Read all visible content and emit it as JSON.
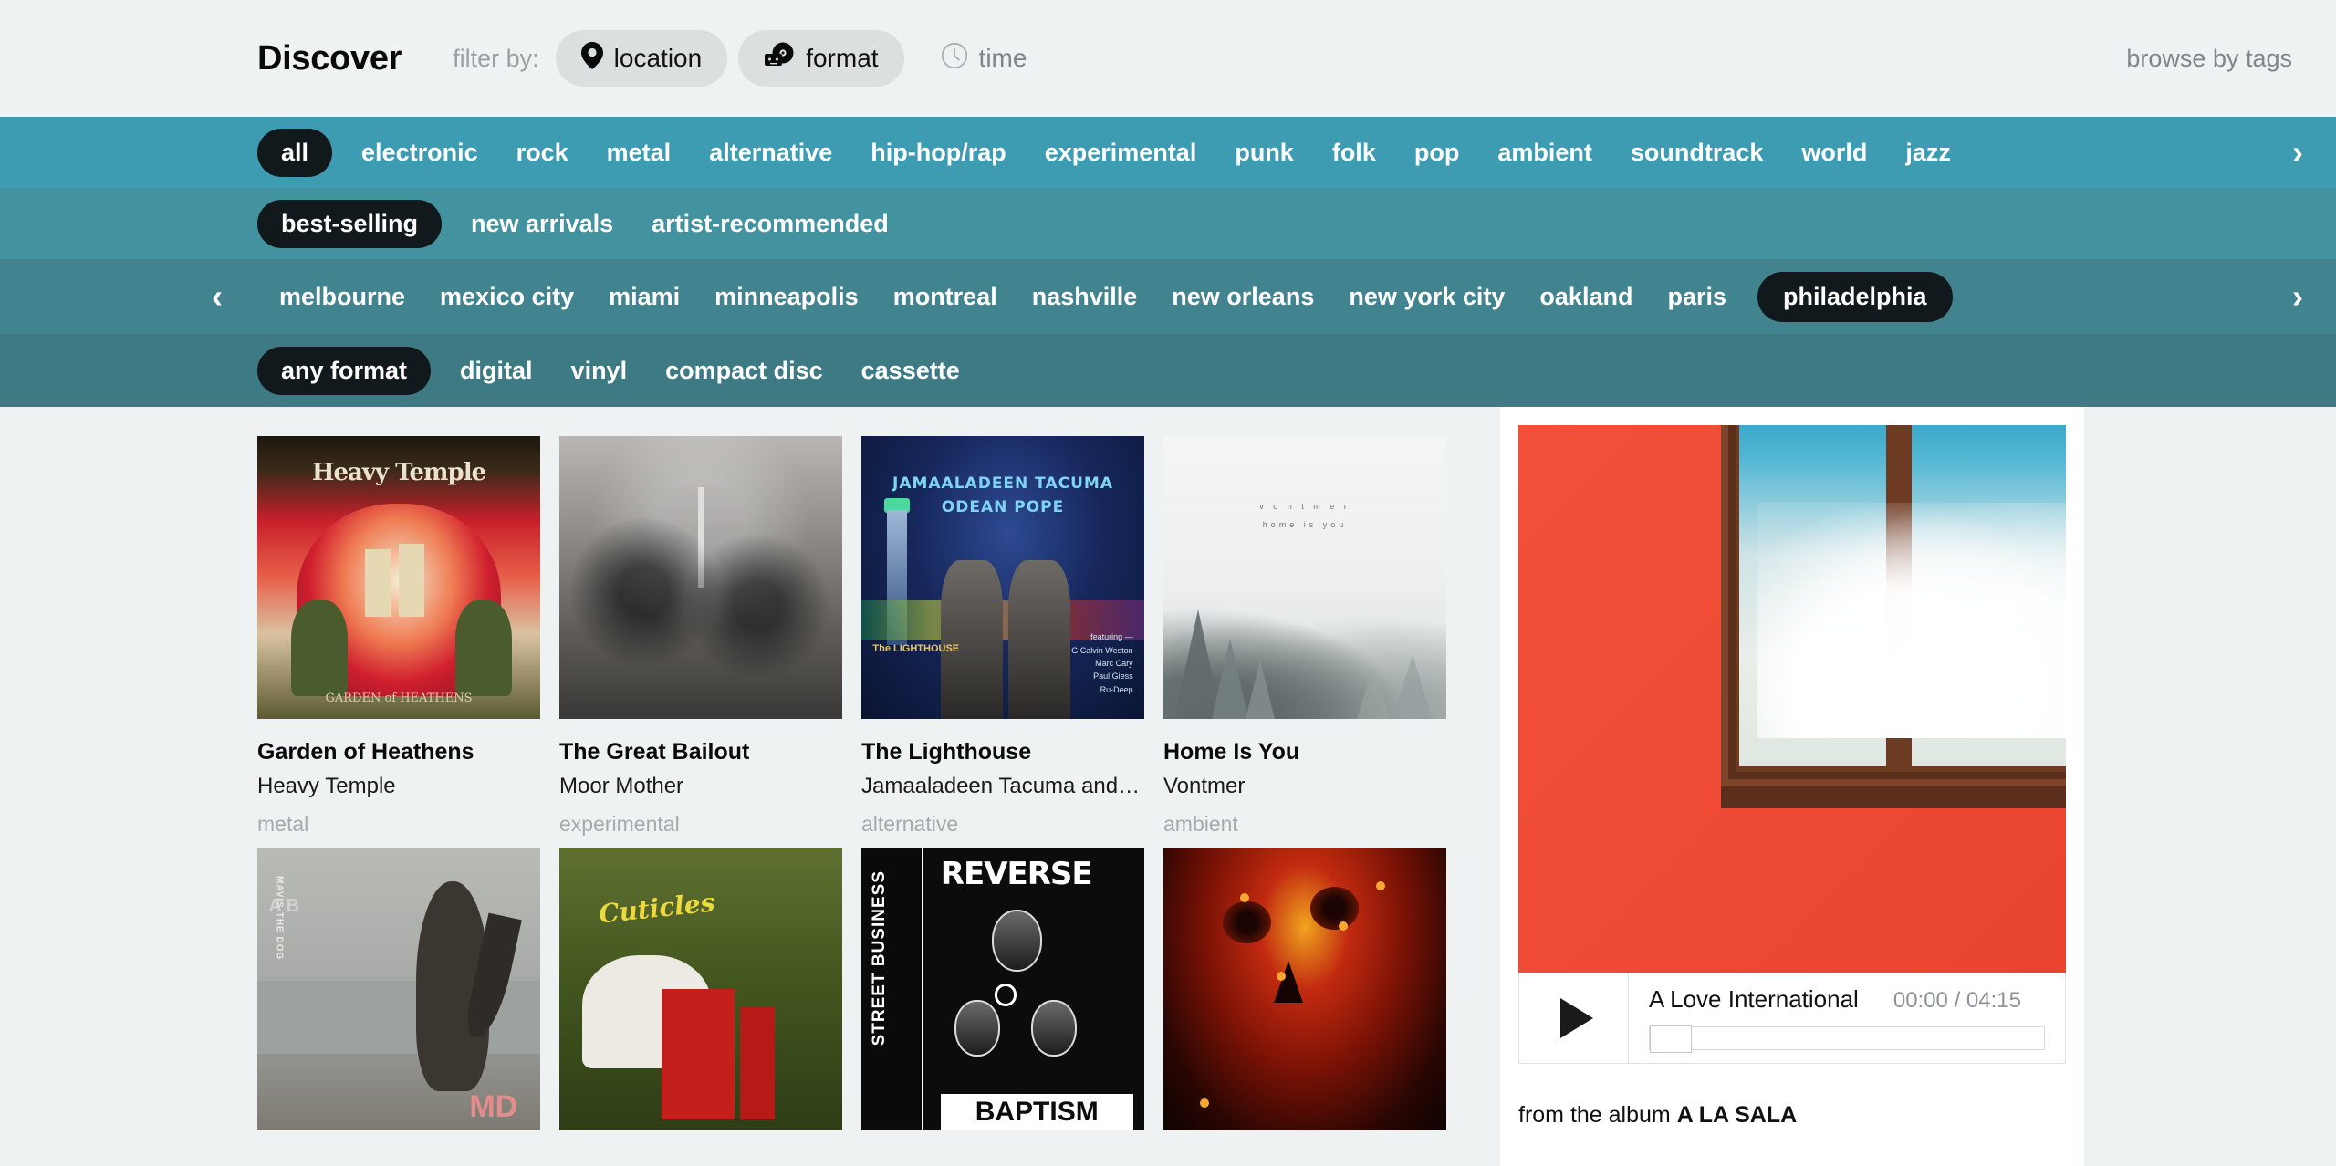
{
  "header": {
    "title": "Discover",
    "filter_label": "filter by:",
    "filters": [
      {
        "label": "location",
        "icon": "map-pin-icon",
        "active": true
      },
      {
        "label": "format",
        "icon": "format-icon",
        "active": true
      },
      {
        "label": "time",
        "icon": "clock-icon",
        "active": false
      }
    ],
    "browse_by_tags": "browse by tags"
  },
  "genres": {
    "selected": "all",
    "items": [
      "all",
      "electronic",
      "rock",
      "metal",
      "alternative",
      "hip-hop/rap",
      "experimental",
      "punk",
      "folk",
      "pop",
      "ambient",
      "soundtrack",
      "world",
      "jazz"
    ],
    "next_arrow": "›"
  },
  "sort": {
    "selected": "best-selling",
    "items": [
      "best-selling",
      "new arrivals",
      "artist-recommended"
    ]
  },
  "locations": {
    "selected": "philadelphia",
    "prev_arrow": "‹",
    "next_arrow": "›",
    "items": [
      "melbourne",
      "mexico city",
      "miami",
      "minneapolis",
      "montreal",
      "nashville",
      "new orleans",
      "new york city",
      "oakland",
      "paris",
      "philadelphia"
    ]
  },
  "formats": {
    "selected": "any format",
    "items": [
      "any format",
      "digital",
      "vinyl",
      "compact disc",
      "cassette"
    ]
  },
  "grid": {
    "items": [
      {
        "title": "Garden of Heathens",
        "artist": "Heavy Temple",
        "genre": "metal",
        "art": "a-metal",
        "art_text": {
          "band": "Heavy Temple",
          "sub": "GARDEN of HEATHENS"
        }
      },
      {
        "title": "The Great Bailout",
        "artist": "Moor Mother",
        "genre": "experimental",
        "art": "a-bw",
        "art_text": {}
      },
      {
        "title": "The Lighthouse",
        "artist": "Jamaaladeen Tacuma and…",
        "genre": "alternative",
        "art": "a-jazz",
        "art_text": {
          "line1": "JAMAALADEEN TACUMA",
          "line2": "ODEAN POPE",
          "small": "The LIGHTHOUSE",
          "featuring": "featuring —\nG.Calvin Weston\nMarc Cary\nPaul Giess\nRu-Deep"
        }
      },
      {
        "title": "Home Is You",
        "artist": "Vontmer",
        "genre": "ambient",
        "art": "a-fog",
        "art_text": {
          "line1": "v o n t m e r",
          "line2": "home is you"
        }
      },
      {
        "title": "",
        "artist": "",
        "genre": "",
        "art": "a-pelican",
        "art_text": {
          "label": "MAVIS THE DOG",
          "big": "MD",
          "ab": "A B"
        }
      },
      {
        "title": "",
        "artist": "",
        "genre": "",
        "art": "a-cut",
        "art_text": {
          "script": "Cuticles"
        }
      },
      {
        "title": "",
        "artist": "",
        "genre": "",
        "art": "a-punk",
        "art_text": {
          "vertical": "STREET BUSINESS",
          "top": "REVERSE",
          "bottom": "BAPTISM"
        }
      },
      {
        "title": "",
        "artist": "",
        "genre": "",
        "art": "a-skull",
        "art_text": {}
      }
    ]
  },
  "player": {
    "track_title": "A Love International",
    "time": "00:00 / 04:15",
    "from_label": "from the album ",
    "album": "A LA SALA",
    "play_icon": "play-icon",
    "progress_percent": 0
  },
  "colors": {
    "header_bg": "#eff2f3",
    "genre_bar": "#3d9cb2",
    "sort_bar": "#42939f",
    "location_bar": "#418490",
    "format_bar": "#3d7a84",
    "pill_dark": "#12191c",
    "accent_red": "#f2503a"
  }
}
